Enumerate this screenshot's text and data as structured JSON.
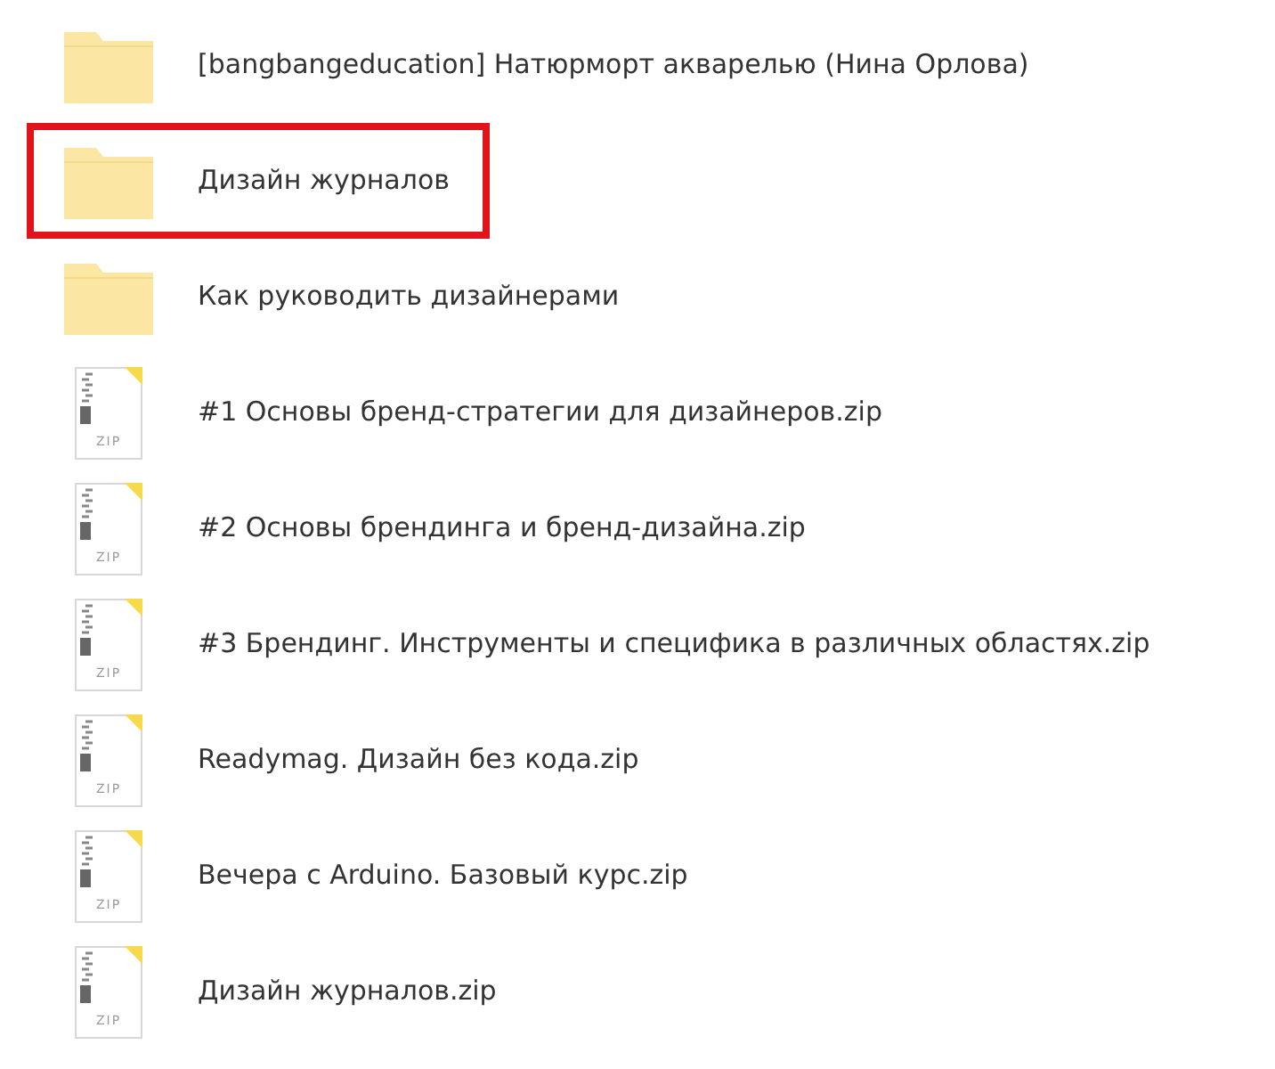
{
  "items": [
    {
      "kind": "folder",
      "name": "[bangbangeducation] Натюрморт акварелью (Нина Орлова)",
      "highlighted": false
    },
    {
      "kind": "folder",
      "name": "Дизайн журналов",
      "highlighted": true
    },
    {
      "kind": "folder",
      "name": "Как руководить дизайнерами",
      "highlighted": false
    },
    {
      "kind": "zip",
      "name": "#1 Основы бренд-стратегии для дизайнеров.zip",
      "badge": "ZIP",
      "highlighted": false
    },
    {
      "kind": "zip",
      "name": "#2 Основы брендинга и бренд-дизайна.zip",
      "badge": "ZIP",
      "highlighted": false
    },
    {
      "kind": "zip",
      "name": "#3 Брендинг. Инструменты и специфика в различных областях.zip",
      "badge": "ZIP",
      "highlighted": false
    },
    {
      "kind": "zip",
      "name": "Readymag. Дизайн без кода.zip",
      "badge": "ZIP",
      "highlighted": false
    },
    {
      "kind": "zip",
      "name": "Вечера с Arduino. Базовый курс.zip",
      "badge": "ZIP",
      "highlighted": false
    },
    {
      "kind": "zip",
      "name": "Дизайн журналов.zip",
      "badge": "ZIP",
      "highlighted": false
    }
  ]
}
